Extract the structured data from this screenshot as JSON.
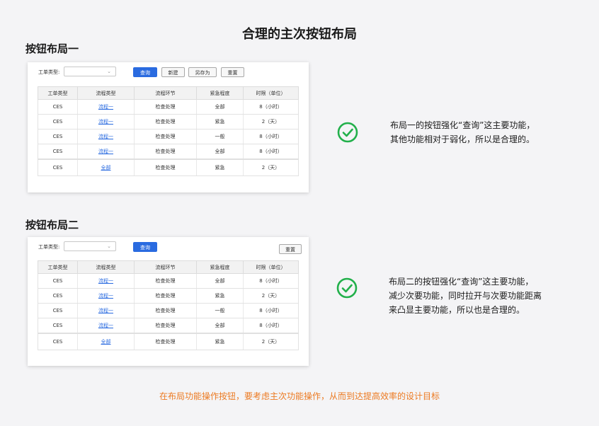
{
  "page_title": "合理的主次按钮布局",
  "layout1": {
    "heading": "按钮布局一",
    "type_label": "工单类型:",
    "buttons": [
      "查询",
      "新建",
      "另存为",
      "重置"
    ],
    "columns": [
      "工单类型",
      "流程类型",
      "流程环节",
      "紧急程度",
      "时限（单位）"
    ],
    "rows": [
      [
        "CES",
        "流程一",
        "检查处理",
        "全部",
        "8（小时）"
      ],
      [
        "CES",
        "流程一",
        "检查处理",
        "紧急",
        "2（天）"
      ],
      [
        "CES",
        "流程一",
        "检查处理",
        "一般",
        "8（小时）"
      ],
      [
        "CES",
        "流程一",
        "检查处理",
        "全部",
        "8（小时）"
      ],
      [
        "CES",
        "全部",
        "检查处理",
        "紧急",
        "2（天）"
      ]
    ],
    "description": [
      "布局一的按钮强化“查询”这主要功能，",
      "其他功能相对于弱化，所以是合理的。"
    ]
  },
  "layout2": {
    "heading": "按钮布局二",
    "type_label": "工单类型:",
    "buttons": [
      "查询",
      "重置"
    ],
    "columns": [
      "工单类型",
      "流程类型",
      "流程环节",
      "紧急程度",
      "时限（单位）"
    ],
    "rows": [
      [
        "CES",
        "流程一",
        "检查处理",
        "全部",
        "8（小时）"
      ],
      [
        "CES",
        "流程一",
        "检查处理",
        "紧急",
        "2（天）"
      ],
      [
        "CES",
        "流程一",
        "检查处理",
        "一般",
        "8（小时）"
      ],
      [
        "CES",
        "流程一",
        "检查处理",
        "全部",
        "8（小时）"
      ],
      [
        "CES",
        "全部",
        "检查处理",
        "紧急",
        "2（天）"
      ]
    ],
    "description": [
      "布局二的按钮强化“查询”这主要功能，",
      "减少次要功能，同时拉开与次要功能距离",
      "来凸显主要功能，所以也是合理的。"
    ]
  },
  "footer_note": "在布局功能操作按钮，要考虑主次功能操作，从而到达提高效率的设计目标",
  "colors": {
    "primary": "#2a6be0",
    "check": "#22b04b",
    "note": "#ec7a22"
  },
  "icons": {
    "check": "check-circle-icon",
    "dropdown": "chevron-down-icon"
  }
}
